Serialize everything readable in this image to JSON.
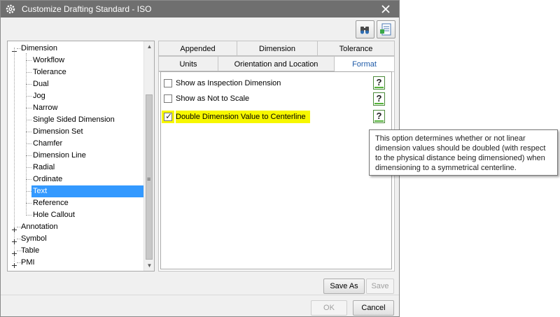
{
  "window": {
    "title": "Customize Drafting Standard - ISO"
  },
  "toolbar": {
    "icons": [
      "binoculars-icon",
      "settings-sheet-icon"
    ]
  },
  "tree": {
    "items": [
      {
        "label": "Dimension",
        "level": 0,
        "expander": "−"
      },
      {
        "label": "Workflow",
        "level": 1
      },
      {
        "label": "Tolerance",
        "level": 1
      },
      {
        "label": "Dual",
        "level": 1
      },
      {
        "label": "Jog",
        "level": 1
      },
      {
        "label": "Narrow",
        "level": 1
      },
      {
        "label": "Single Sided Dimension",
        "level": 1
      },
      {
        "label": "Dimension Set",
        "level": 1
      },
      {
        "label": "Chamfer",
        "level": 1
      },
      {
        "label": "Dimension Line",
        "level": 1
      },
      {
        "label": "Radial",
        "level": 1
      },
      {
        "label": "Ordinate",
        "level": 1
      },
      {
        "label": "Text",
        "level": 1,
        "selected": true
      },
      {
        "label": "Reference",
        "level": 1
      },
      {
        "label": "Hole Callout",
        "level": 1
      },
      {
        "label": "Annotation",
        "level": 0,
        "expander": "+"
      },
      {
        "label": "Symbol",
        "level": 0,
        "expander": "+"
      },
      {
        "label": "Table",
        "level": 0,
        "expander": "+"
      },
      {
        "label": "PMI",
        "level": 0,
        "expander": "+"
      }
    ],
    "scroll_up": "▲",
    "scroll_down": "▼",
    "scroll_grip": "≡"
  },
  "tabs": {
    "row1": [
      "Appended",
      "Dimension",
      "Tolerance"
    ],
    "row2": [
      "Units",
      "Orientation and Location",
      "Format"
    ],
    "active": "Format"
  },
  "options": [
    {
      "label": "Show as Inspection Dimension",
      "checked": false
    },
    {
      "label": "Show as Not to Scale",
      "checked": false
    },
    {
      "label": "Double Dimension Value to Centerline",
      "checked": true,
      "highlighted": true
    }
  ],
  "help_glyph": "?",
  "check_glyph": "✓",
  "tooltip": {
    "text": "This option determines whether or not linear dimension values should be doubled (with respect to the physical distance being dimensioned) when dimensioning to a symmetrical centerline."
  },
  "buttons": {
    "save_as": "Save As",
    "save": "Save",
    "ok": "OK",
    "cancel": "Cancel"
  },
  "colors": {
    "titlebar": "#6f6f6f",
    "selection": "#3399ff",
    "highlight": "#f7f700",
    "active_tab_text": "#1e5aa8"
  }
}
